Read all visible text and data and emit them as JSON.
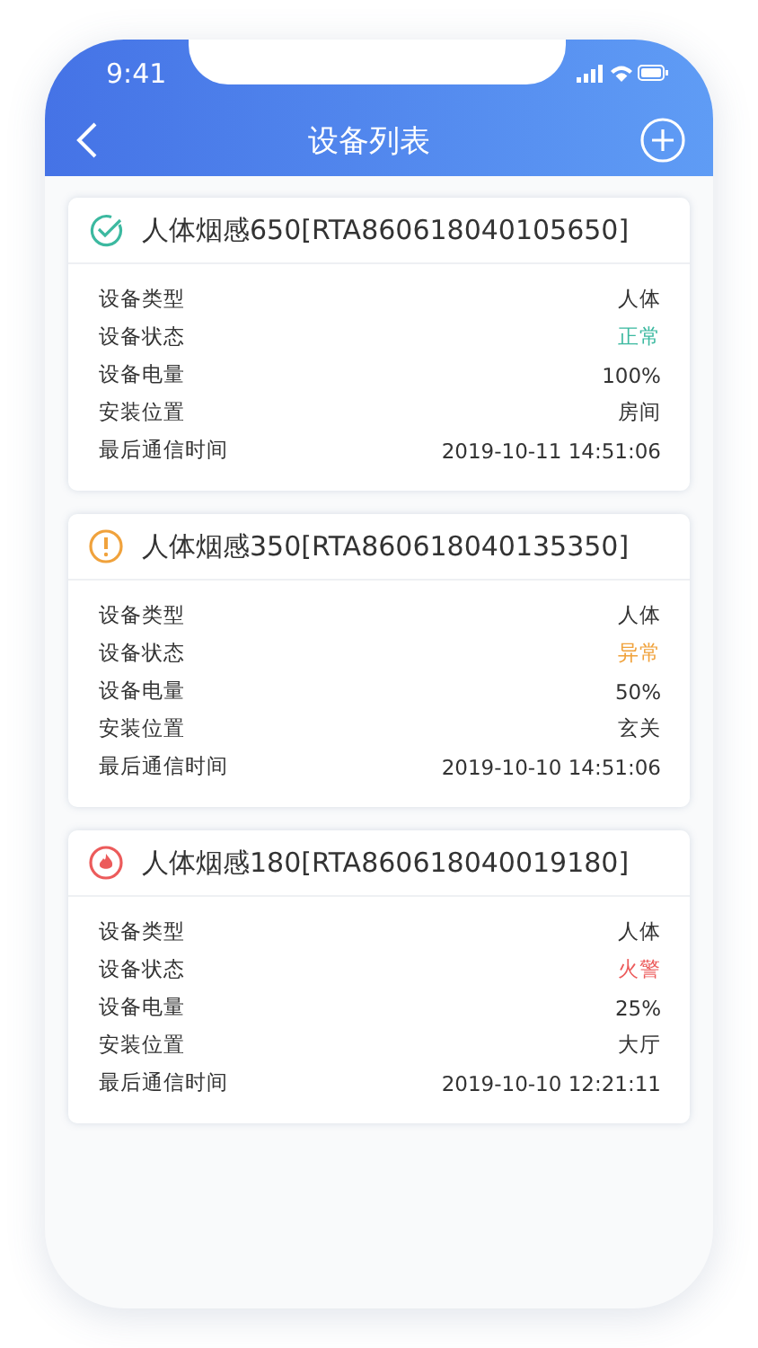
{
  "status_bar": {
    "time": "9:41"
  },
  "nav": {
    "title": "设备列表"
  },
  "devices": [
    {
      "name": "人体烟感650[RTA860618040105650]",
      "kind": "normal",
      "color": "#3cb9a0",
      "rows": [
        {
          "label": "设备类型",
          "value": "人体",
          "kind": "plain"
        },
        {
          "label": "设备状态",
          "value": "正常",
          "kind": "status"
        },
        {
          "label": "设备电量",
          "value": "100%",
          "kind": "plain"
        },
        {
          "label": "安装位置",
          "value": "房间",
          "kind": "plain"
        },
        {
          "label": "最后通信时间",
          "value": "2019-10-11 14:51:06",
          "kind": "plain"
        }
      ]
    },
    {
      "name": "人体烟感350[RTA860618040135350]",
      "kind": "warning",
      "color": "#f0a23c",
      "rows": [
        {
          "label": "设备类型",
          "value": "人体",
          "kind": "plain"
        },
        {
          "label": "设备状态",
          "value": "异常",
          "kind": "status"
        },
        {
          "label": "设备电量",
          "value": "50%",
          "kind": "plain"
        },
        {
          "label": "安装位置",
          "value": "玄关",
          "kind": "plain"
        },
        {
          "label": "最后通信时间",
          "value": "2019-10-10 14:51:06",
          "kind": "plain"
        }
      ]
    },
    {
      "name": "人体烟感180[RTA860618040019180]",
      "kind": "fire",
      "color": "#ec5b5b",
      "rows": [
        {
          "label": "设备类型",
          "value": "人体",
          "kind": "plain"
        },
        {
          "label": "设备状态",
          "value": "火警",
          "kind": "status"
        },
        {
          "label": "设备电量",
          "value": "25%",
          "kind": "plain"
        },
        {
          "label": "安装位置",
          "value": "大厅",
          "kind": "plain"
        },
        {
          "label": "最后通信时间",
          "value": "2019-10-10 12:21:11",
          "kind": "plain"
        }
      ]
    }
  ]
}
